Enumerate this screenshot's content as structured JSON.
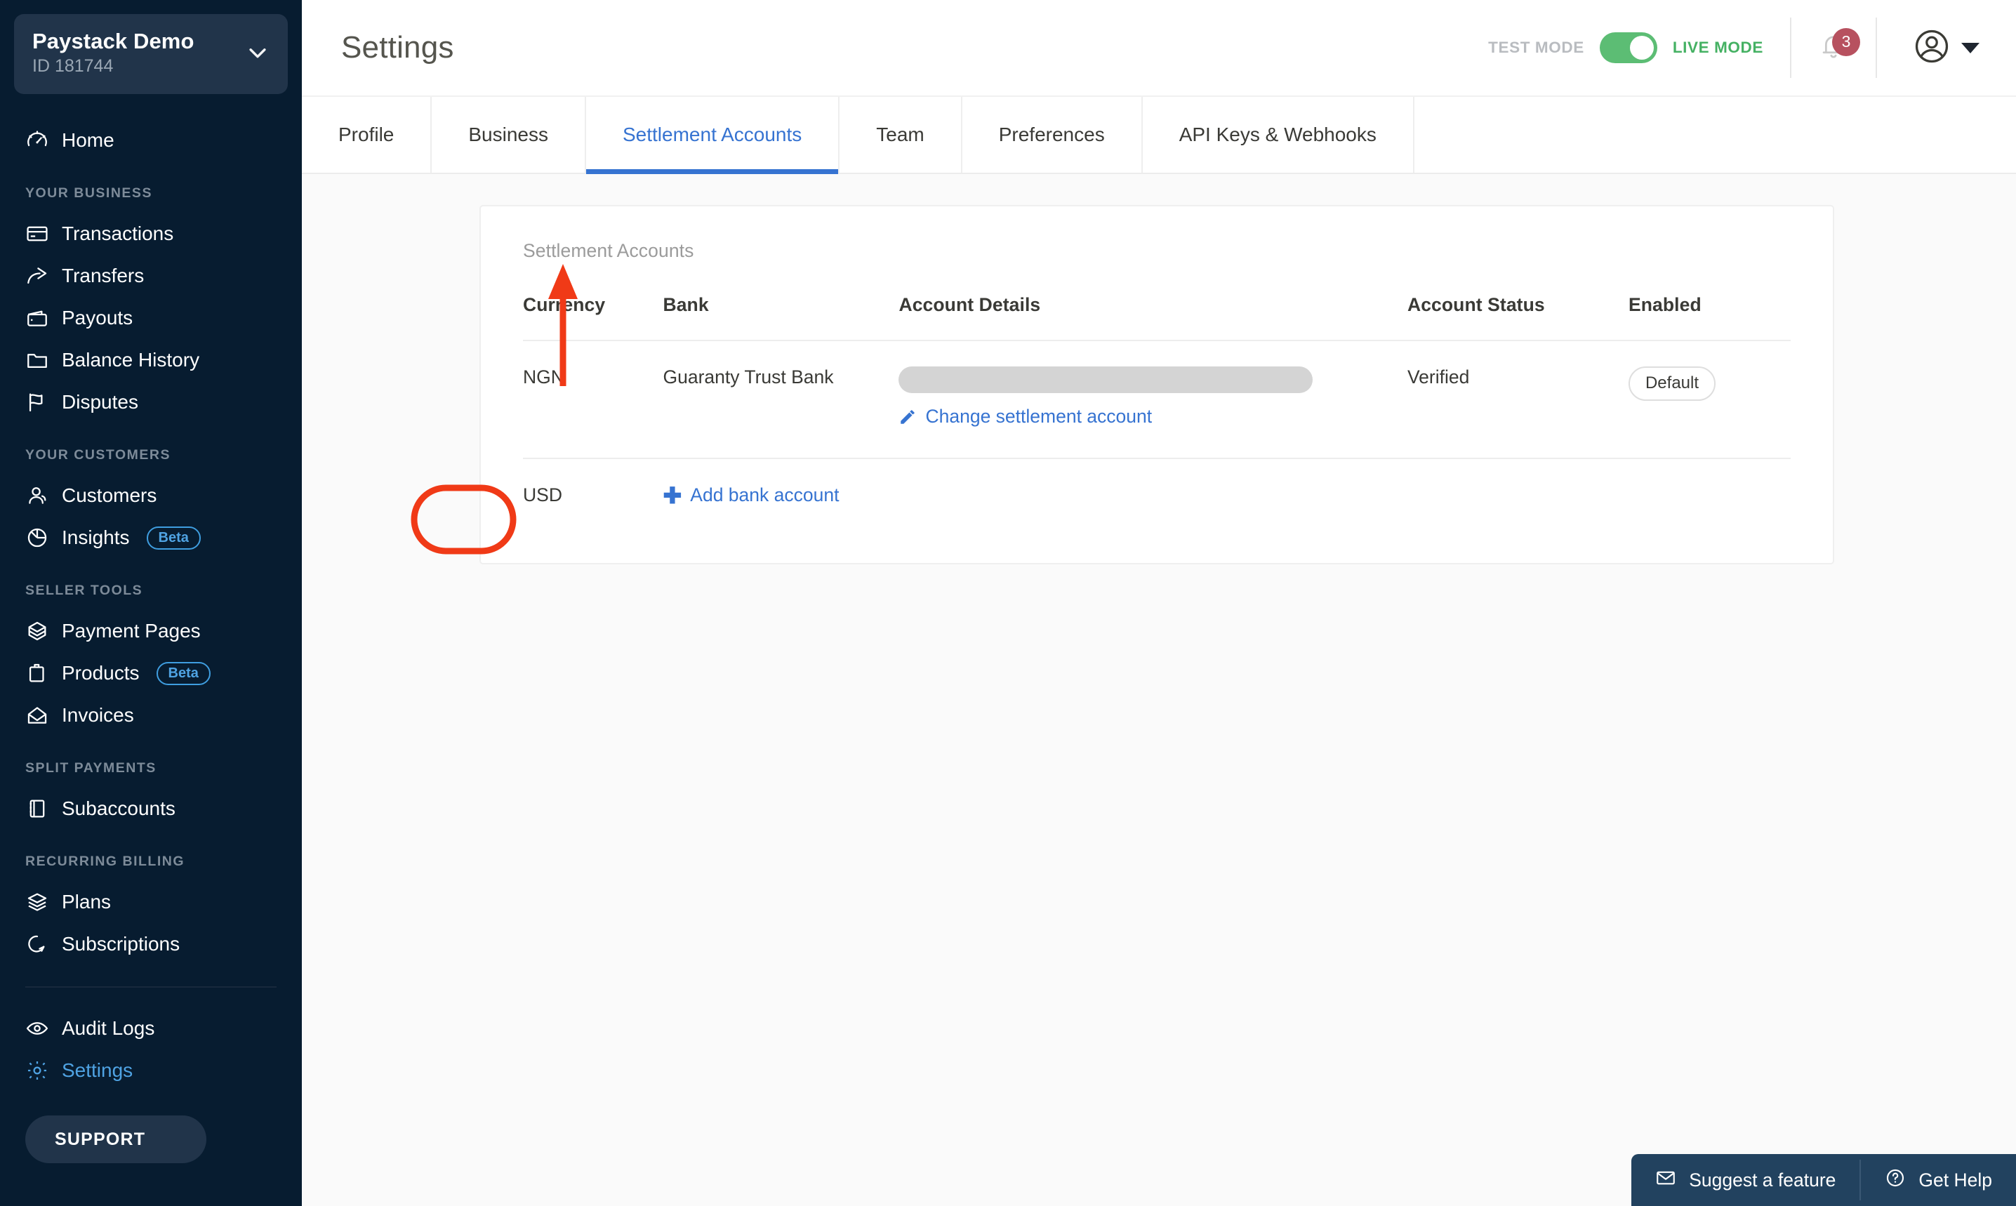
{
  "sidebar": {
    "brand": {
      "name": "Paystack Demo",
      "id": "ID 181744",
      "chevron_icon": "chevron-down-icon"
    },
    "home": {
      "label": "Home",
      "icon": "speedometer-icon"
    },
    "sections": [
      {
        "label": "YOUR BUSINESS",
        "items": [
          {
            "label": "Transactions",
            "icon": "credit-card-icon"
          },
          {
            "label": "Transfers",
            "icon": "share-arrow-icon"
          },
          {
            "label": "Payouts",
            "icon": "wallet-icon"
          },
          {
            "label": "Balance History",
            "icon": "folder-icon"
          },
          {
            "label": "Disputes",
            "icon": "flag-icon"
          }
        ]
      },
      {
        "label": "YOUR CUSTOMERS",
        "items": [
          {
            "label": "Customers",
            "icon": "users-icon"
          },
          {
            "label": "Insights",
            "icon": "pie-chart-icon",
            "badge": "Beta"
          }
        ]
      },
      {
        "label": "SELLER TOOLS",
        "items": [
          {
            "label": "Payment Pages",
            "icon": "open-box-icon"
          },
          {
            "label": "Products",
            "icon": "clipboard-icon",
            "badge": "Beta"
          },
          {
            "label": "Invoices",
            "icon": "open-envelope-icon"
          }
        ]
      },
      {
        "label": "SPLIT PAYMENTS",
        "items": [
          {
            "label": "Subaccounts",
            "icon": "notebook-icon"
          }
        ]
      },
      {
        "label": "RECURRING BILLING",
        "items": [
          {
            "label": "Plans",
            "icon": "layers-icon"
          },
          {
            "label": "Subscriptions",
            "icon": "refresh-loop-icon"
          }
        ]
      }
    ],
    "footer_items": [
      {
        "label": "Audit Logs",
        "icon": "eye-icon",
        "active": false
      },
      {
        "label": "Settings",
        "icon": "gear-icon",
        "active": true
      }
    ],
    "support": {
      "label": "SUPPORT",
      "icon": "question-circle-icon"
    }
  },
  "topbar": {
    "title": "Settings",
    "mode": {
      "off_label": "TEST MODE",
      "on_label": "LIVE MODE",
      "state": "live"
    },
    "notifications": {
      "icon": "bell-icon",
      "count": "3"
    },
    "avatar": {
      "icon": "user-circle-icon",
      "caret_icon": "caret-down-icon"
    }
  },
  "tabs": [
    {
      "label": "Profile",
      "active": false
    },
    {
      "label": "Business",
      "active": false
    },
    {
      "label": "Settlement Accounts",
      "active": true
    },
    {
      "label": "Team",
      "active": false
    },
    {
      "label": "Preferences",
      "active": false
    },
    {
      "label": "API Keys & Webhooks",
      "active": false
    }
  ],
  "card": {
    "title": "Settlement Accounts",
    "columns": [
      "Currency",
      "Bank",
      "Account Details",
      "Account Status",
      "Enabled"
    ],
    "rows": [
      {
        "currency": "NGN",
        "bank": "Guaranty Trust Bank",
        "account_details_redacted": true,
        "change_link": "Change settlement account",
        "change_link_icon": "pencil-icon",
        "status": "Verified",
        "enabled_chip": "Default"
      },
      {
        "currency": "USD",
        "add_link": "Add bank account",
        "add_link_icon": "plus-icon"
      }
    ]
  },
  "annotations": {
    "highlight_color": "#f03a17",
    "highlight_target": "USD",
    "arrow_points_to": "Add bank account"
  },
  "floatbar": {
    "suggest": {
      "label": "Suggest a feature",
      "icon": "envelope-icon"
    },
    "help": {
      "label": "Get Help",
      "icon": "question-circle-icon"
    }
  }
}
